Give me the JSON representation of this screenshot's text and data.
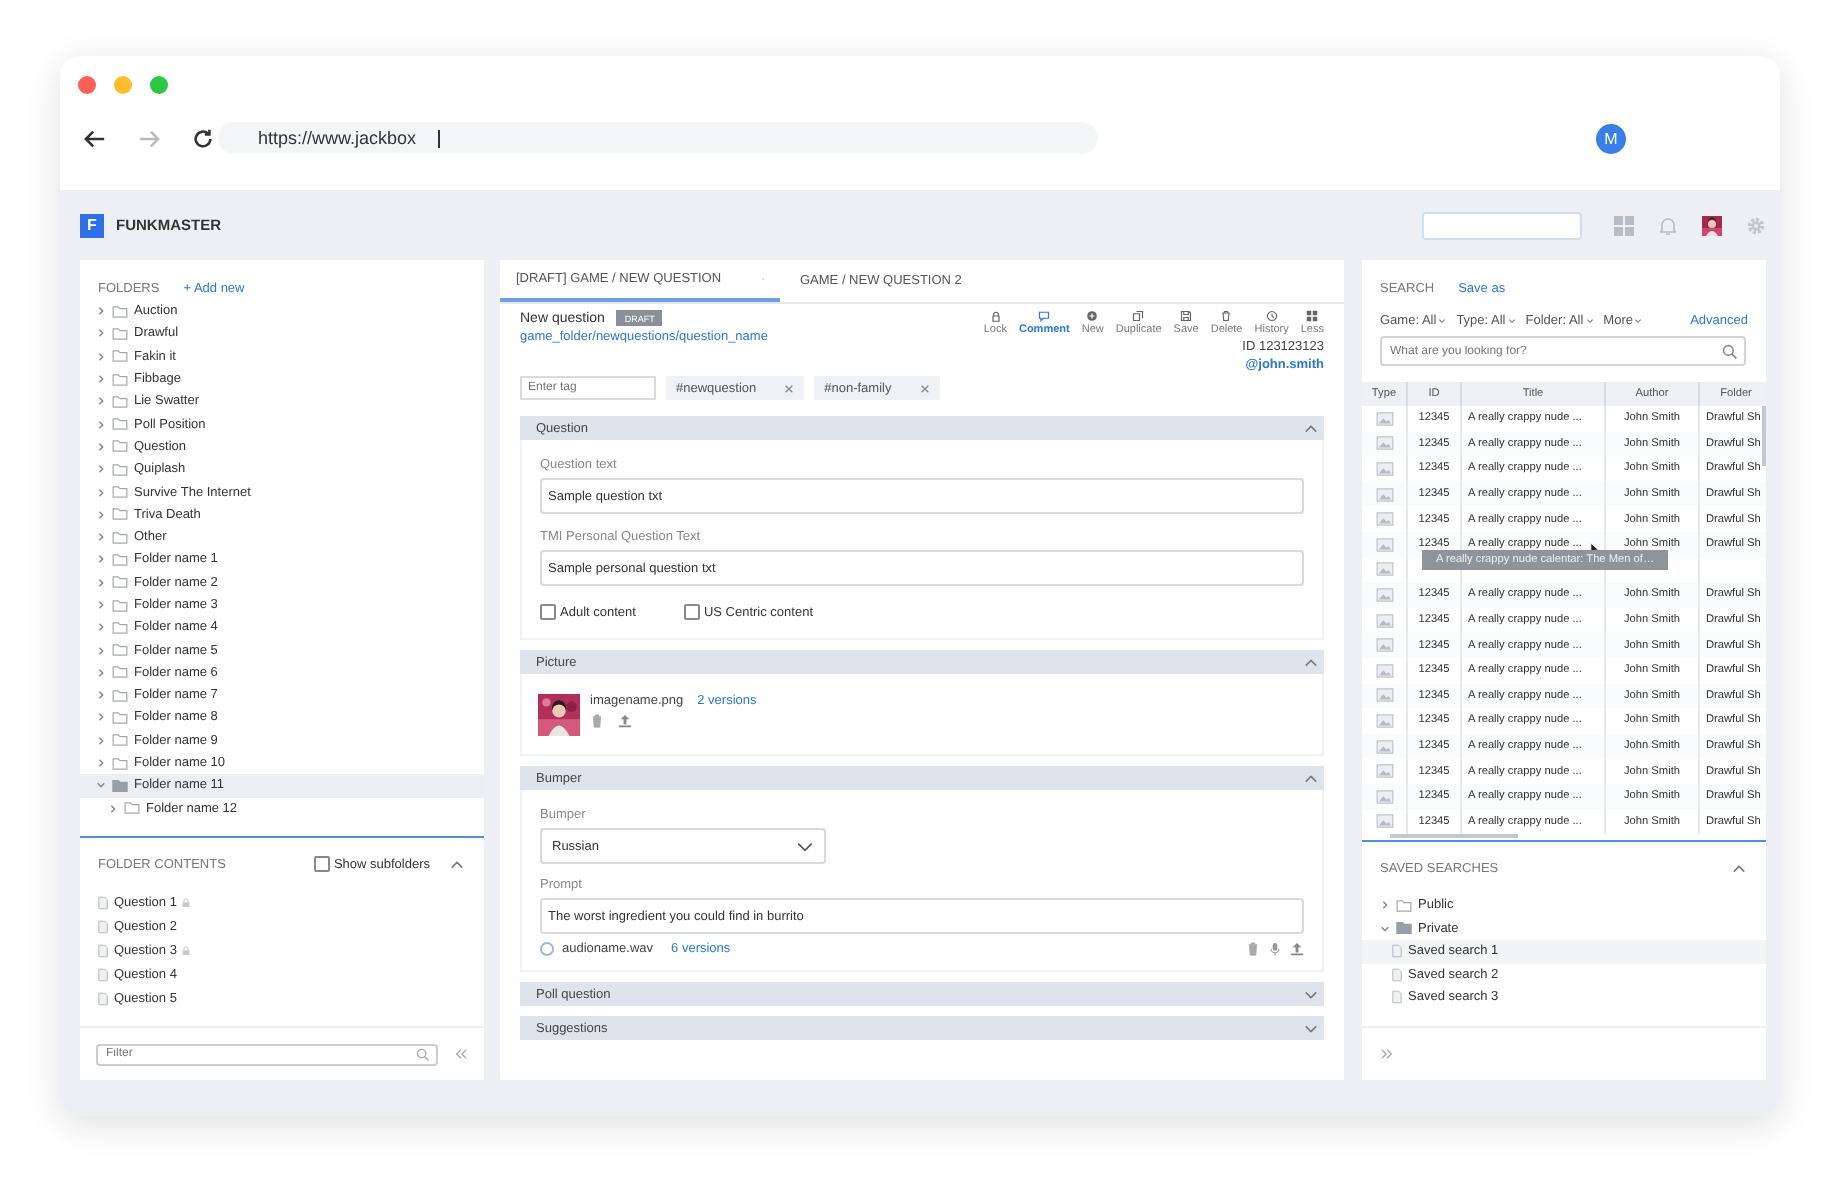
{
  "browser": {
    "url": "https://www.jackbox",
    "profile_initial": "M"
  },
  "app": {
    "logo_letter": "F",
    "name": "FUNKMASTER"
  },
  "folders": {
    "title": "FOLDERS",
    "add_label": "+ Add new",
    "items": [
      {
        "label": "Auction",
        "expanded": false,
        "selected": false
      },
      {
        "label": "Drawful",
        "expanded": false,
        "selected": false
      },
      {
        "label": "Fakin it",
        "expanded": false,
        "selected": false
      },
      {
        "label": "Fibbage",
        "expanded": false,
        "selected": false
      },
      {
        "label": "Lie Swatter",
        "expanded": false,
        "selected": false
      },
      {
        "label": "Poll Position",
        "expanded": false,
        "selected": false
      },
      {
        "label": "Question",
        "expanded": false,
        "selected": false
      },
      {
        "label": "Quiplash",
        "expanded": false,
        "selected": false
      },
      {
        "label": "Survive The Internet",
        "expanded": false,
        "selected": false
      },
      {
        "label": "Triva Death",
        "expanded": false,
        "selected": false
      },
      {
        "label": "Other",
        "expanded": false,
        "selected": false
      },
      {
        "label": "Folder name 1",
        "expanded": false,
        "selected": false
      },
      {
        "label": "Folder name 2",
        "expanded": false,
        "selected": false
      },
      {
        "label": "Folder name 3",
        "expanded": false,
        "selected": false
      },
      {
        "label": "Folder name 4",
        "expanded": false,
        "selected": false
      },
      {
        "label": "Folder name 5",
        "expanded": false,
        "selected": false
      },
      {
        "label": "Folder name 6",
        "expanded": false,
        "selected": false
      },
      {
        "label": "Folder name 7",
        "expanded": false,
        "selected": false
      },
      {
        "label": "Folder name 8",
        "expanded": false,
        "selected": false
      },
      {
        "label": "Folder name 9",
        "expanded": false,
        "selected": false
      },
      {
        "label": "Folder name 10",
        "expanded": false,
        "selected": false
      },
      {
        "label": "Folder name 11",
        "expanded": true,
        "selected": true,
        "children": [
          {
            "label": "Folder name 12",
            "expanded": false,
            "selected": false
          }
        ]
      }
    ]
  },
  "folder_contents": {
    "title": "FOLDER CONTENTS",
    "show_subfolders": {
      "label": "Show subfolders",
      "checked": false
    },
    "items": [
      {
        "label": "Question 1",
        "locked": true
      },
      {
        "label": "Question 2",
        "locked": false
      },
      {
        "label": "Question 3",
        "locked": true
      },
      {
        "label": "Question 4",
        "locked": false
      },
      {
        "label": "Question 5",
        "locked": false
      }
    ],
    "filter_placeholder": "Filter"
  },
  "editor": {
    "tabs": [
      {
        "label": "[DRAFT] GAME / NEW QUESTION",
        "selected": true,
        "closable": true
      },
      {
        "label": "GAME / NEW QUESTION 2",
        "selected": false,
        "closable": false
      }
    ],
    "title": "New question",
    "badge": "DRAFT",
    "path": "game_folder/newquestions/question_name",
    "toolbar": [
      {
        "label": "Lock",
        "selected": false
      },
      {
        "label": "Comment",
        "selected": true
      },
      {
        "label": "New",
        "selected": false
      },
      {
        "label": "Duplicate",
        "selected": false
      },
      {
        "label": "Save",
        "selected": false
      },
      {
        "label": "Delete",
        "selected": false
      },
      {
        "label": "History",
        "selected": false
      },
      {
        "label": "Less",
        "selected": false
      }
    ],
    "id_text": "ID 123123123",
    "author": "@john.smith",
    "tag_placeholder": "Enter tag",
    "tags": [
      "#newquestion",
      "#non-family"
    ],
    "sections": [
      {
        "kind": "question",
        "title": "Question",
        "expanded": true,
        "fields": [
          {
            "label": "Question text",
            "value": "Sample question txt"
          },
          {
            "label": "TMI Personal Question Text",
            "value": "Sample personal question txt"
          }
        ],
        "checkboxes": [
          {
            "label": "Adult content",
            "checked": false
          },
          {
            "label": "US Centric content",
            "checked": false
          }
        ]
      },
      {
        "kind": "picture",
        "title": "Picture",
        "expanded": true,
        "file": "imagename.png",
        "versions": "2 versions"
      },
      {
        "kind": "bumper",
        "title": "Bumper",
        "expanded": true,
        "select_label": "Bumper",
        "select_value": "Russian",
        "prompt_label": "Prompt",
        "prompt_value": "The worst ingredient you could find in burrito",
        "audio_file": "audioname.wav",
        "audio_selected": false,
        "audio_versions": "6 versions"
      },
      {
        "title": "Poll question",
        "expanded": false
      },
      {
        "title": "Suggestions",
        "expanded": false
      }
    ]
  },
  "search": {
    "title": "SEARCH",
    "save_as": "Save as",
    "filters": [
      "Game: All",
      "Type: All",
      "Folder: All",
      "More"
    ],
    "advanced": "Advanced",
    "placeholder": "What are you looking for?"
  },
  "table": {
    "columns": [
      "Type",
      "ID",
      "Title",
      "Author",
      "Folder"
    ],
    "rows": [
      {
        "id": "12345",
        "title": "A really crappy nude ...",
        "author": "John Smith",
        "folder": "Drawful Sh"
      },
      {
        "id": "12345",
        "title": "A really crappy nude ...",
        "author": "John Smith",
        "folder": "Drawful Sh"
      },
      {
        "id": "12345",
        "title": "A really crappy nude ...",
        "author": "John Smith",
        "folder": "Drawful Sh"
      },
      {
        "id": "12345",
        "title": "A really crappy nude ...",
        "author": "John Smith",
        "folder": "Drawful Sh"
      },
      {
        "id": "12345",
        "title": "A really crappy nude ...",
        "author": "John Smith",
        "folder": "Drawful Sh"
      },
      {
        "id": "12345",
        "title": "A really crappy nude ...",
        "author": "John Smith",
        "folder": "Drawful Sh",
        "tooltip": "A really crappy nude calentar: The Men of…"
      },
      {},
      {
        "id": "12345",
        "title": "A really crappy nude ...",
        "author": "John Smith",
        "folder": "Drawful Sh"
      },
      {
        "id": "12345",
        "title": "A really crappy nude ...",
        "author": "John Smith",
        "folder": "Drawful Sh"
      },
      {
        "id": "12345",
        "title": "A really crappy nude ...",
        "author": "John Smith",
        "folder": "Drawful Sh"
      },
      {
        "id": "12345",
        "title": "A really crappy nude ...",
        "author": "John Smith",
        "folder": "Drawful Sh"
      },
      {
        "id": "12345",
        "title": "A really crappy nude ...",
        "author": "John Smith",
        "folder": "Drawful Sh"
      },
      {
        "id": "12345",
        "title": "A really crappy nude ...",
        "author": "John Smith",
        "folder": "Drawful Sh"
      },
      {
        "id": "12345",
        "title": "A really crappy nude ...",
        "author": "John Smith",
        "folder": "Drawful Sh"
      },
      {
        "id": "12345",
        "title": "A really crappy nude ...",
        "author": "John Smith",
        "folder": "Drawful Sh"
      },
      {
        "id": "12345",
        "title": "A really crappy nude ...",
        "author": "John Smith",
        "folder": "Drawful Sh"
      },
      {
        "id": "12345",
        "title": "A really crappy nude ...",
        "author": "John Smith",
        "folder": "Drawful Sh"
      }
    ]
  },
  "saved_searches": {
    "title": "SAVED SEARCHES",
    "items": [
      {
        "label": "Public",
        "expanded": false
      },
      {
        "label": "Private",
        "expanded": true,
        "children": [
          {
            "label": "Saved search 1",
            "selected": true
          },
          {
            "label": "Saved search 2",
            "selected": false
          },
          {
            "label": "Saved search 3",
            "selected": false
          }
        ]
      }
    ]
  }
}
